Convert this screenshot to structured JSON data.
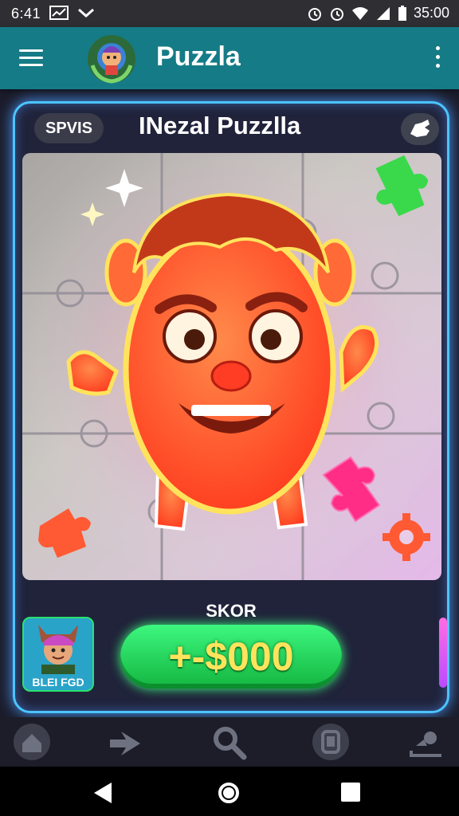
{
  "status_bar": {
    "time": "6:41",
    "clock_right": "35:00",
    "icons_left": [
      "chart-icon",
      "chevron-down-icon"
    ],
    "icons_right": [
      "alarm-icon",
      "alarm-icon",
      "wifi-icon",
      "signal-icon",
      "battery-icon"
    ]
  },
  "app_bar": {
    "title": "Puzzla",
    "menu_icon": "hamburger-icon",
    "more_icon": "more-vertical-icon"
  },
  "card": {
    "pill_label": "SPVIS",
    "title": "INezal Puzzlla",
    "hint_icon": "hint-hand-icon"
  },
  "board": {
    "grid": "3x3",
    "tiles": 9,
    "colors": {
      "character": "#ff5a2a",
      "glow": "#ffd84a",
      "piece_green": "#39d94b",
      "piece_pink": "#ff2d86",
      "piece_orange": "#ff5a33"
    }
  },
  "score": {
    "label": "SKOR",
    "value": "+-$000"
  },
  "player": {
    "name": "BLEI FGD"
  },
  "bottom_nav": {
    "items": [
      "home-icon",
      "arrow-right-icon",
      "search-icon",
      "tablet-icon",
      "profile-icon"
    ]
  },
  "system_nav": [
    "back-icon",
    "home-circle-icon",
    "recents-icon"
  ],
  "colors": {
    "app_bar": "#157b86",
    "card_border": "#4bc4ff",
    "score_button": "#22d95a",
    "score_text": "#ffe35c"
  }
}
